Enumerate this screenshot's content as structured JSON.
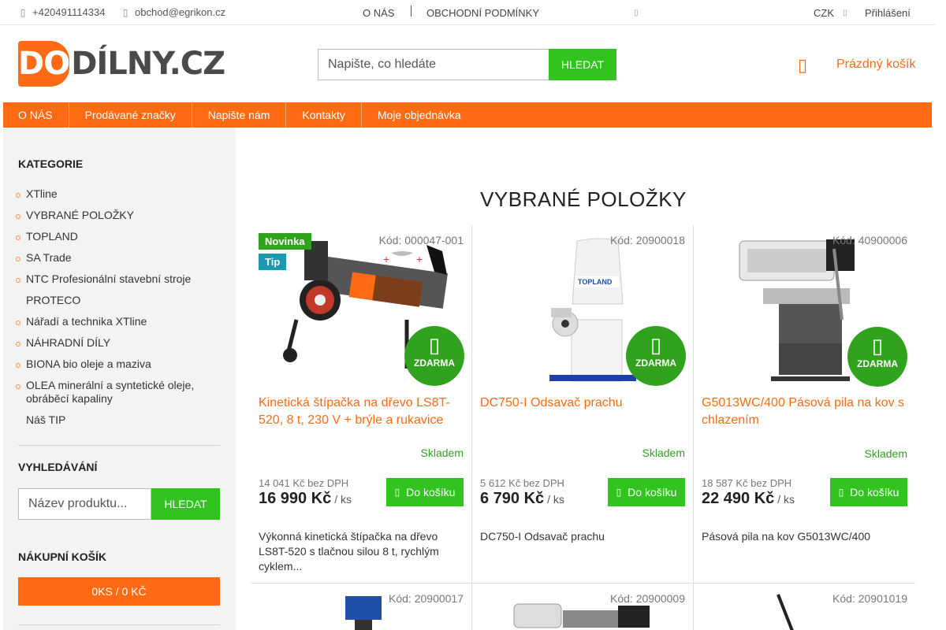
{
  "topbar": {
    "phone": "+420491114334",
    "email": "obchod@egrikon.cz",
    "about": "O NÁS",
    "terms": "OBCHODNÍ PODMÍNKY",
    "currency": "CZK",
    "login": "Přihlášení",
    "phone_icon": "phone-icon",
    "email_icon": "email-icon"
  },
  "logo": {
    "part1": "DO",
    "part2": "DÍLNY.CZ"
  },
  "search": {
    "placeholder": "Napište, co hledáte",
    "button": "HLEDAT"
  },
  "cart": {
    "label": "Prázdný košík",
    "icon": "cart-icon"
  },
  "nav": [
    "O NÁS",
    "Prodávané značky",
    "Napište nám",
    "Kontakty",
    "Moje objednávka"
  ],
  "sidebar": {
    "categories_title": "KATEGORIE",
    "categories": [
      {
        "label": "XTline",
        "dot": true
      },
      {
        "label": "VYBRANÉ POLOŽKY",
        "dot": true
      },
      {
        "label": "TOPLAND",
        "dot": true
      },
      {
        "label": "SA Trade",
        "dot": true
      },
      {
        "label": "NTC Profesionální stavební stroje",
        "dot": true
      },
      {
        "label": "PROTECO",
        "dot": false
      },
      {
        "label": "Nářadí a technika XTline",
        "dot": true
      },
      {
        "label": "NÁHRADNÍ DÍLY",
        "dot": true
      },
      {
        "label": "BIONA bio oleje a maziva",
        "dot": true
      },
      {
        "label": "OLEA minerální a syntetické oleje, obráběcí kapaliny",
        "dot": true
      },
      {
        "label": "Náš TIP",
        "dot": false
      }
    ],
    "search_title": "VYHLEDÁVÁNÍ",
    "search_placeholder": "Název produktu...",
    "search_button": "HLEDAT",
    "cart_title": "NÁKUPNÍ KOŠÍK",
    "cart_summary": "0KS / 0 KČ"
  },
  "main": {
    "title": "VYBRANÉ POLOŽKY",
    "free_label": "ZDARMA",
    "stock_label": "Skladem",
    "buy_label": "Do košíku",
    "unit": "/ ks",
    "products": [
      {
        "code": "Kód: 000047-001",
        "badges": [
          "Novinka",
          "Tip"
        ],
        "name": "Kinetická štípačka na dřevo LS8T-520, 8 t, 230 V + brýle a rukavice",
        "price_ex_vat": "14 041 Kč bez DPH",
        "price": "16 990 Kč",
        "description": "Výkonná kinetická štípačka na dřevo LS8T-520 s tlačnou silou 8 t, rychlým cyklem...",
        "image": "log-splitter"
      },
      {
        "code": "Kód: 20900018",
        "badges": [],
        "name": "DC750-I Odsavač prachu",
        "price_ex_vat": "5 612 Kč bez DPH",
        "price": "6 790 Kč",
        "description": "DC750-I Odsavač prachu",
        "image": "dust-extractor",
        "image_text": "TOPLAND"
      },
      {
        "code": "Kód: 40900006",
        "badges": [],
        "name": "G5013WC/400 Pásová pila na kov s chlazením",
        "price_ex_vat": "18 587 Kč bez DPH",
        "price": "22 490 Kč",
        "description": "Pásová pila na kov G5013WC/400",
        "image": "band-saw"
      }
    ],
    "row2_codes": [
      "Kód: 20900017",
      "Kód: 20900009",
      "Kód: 20901019"
    ]
  }
}
